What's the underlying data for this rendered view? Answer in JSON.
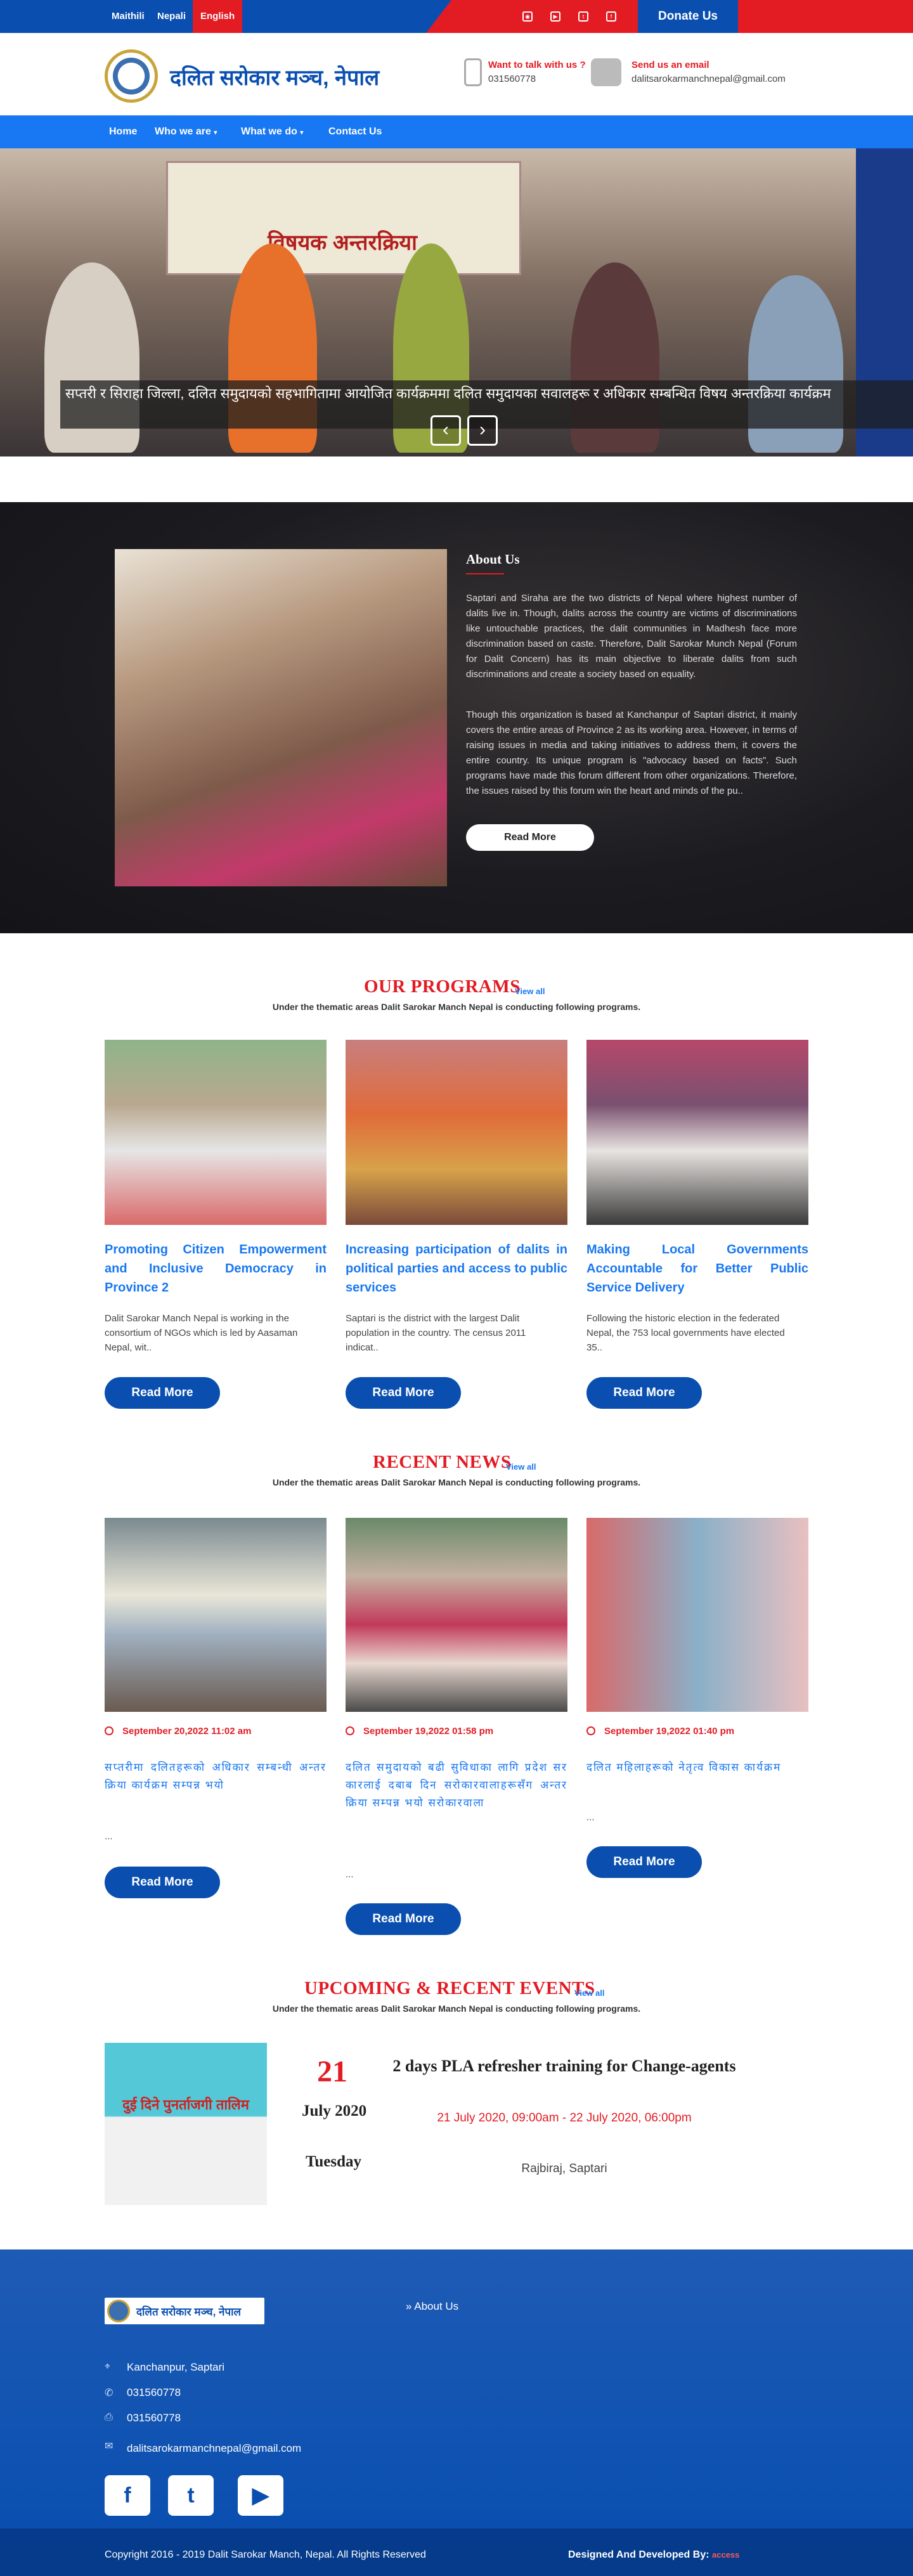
{
  "topbar": {
    "languages": [
      "Maithili",
      "Nepali",
      "English"
    ],
    "active_language": "English",
    "social_icons": [
      "instagram-icon",
      "youtube-icon",
      "twitter-icon",
      "facebook-icon"
    ],
    "donate_label": "Donate Us"
  },
  "header": {
    "site_title": "दलित सरोकार मञ्च, नेपाल",
    "phone_label": "Want to talk with us ?",
    "phone_value": "031560778",
    "email_label": "Send us an email",
    "email_value": "dalitsarokarmanchnepal@gmail.com"
  },
  "nav": {
    "items": [
      {
        "label": "Home",
        "dropdown": false
      },
      {
        "label": "Who we are",
        "dropdown": true
      },
      {
        "label": "What we do",
        "dropdown": true
      },
      {
        "label": "Contact Us",
        "dropdown": false
      }
    ]
  },
  "slider": {
    "banner_text": "विषयक अन्तरक्रिया",
    "caption": "सप्तरी र सिराहा जिल्ला, दलित समुदायको सहभागितामा आयोजित कार्यक्रममा दलित समुदायका सवालहरू र अधिकार सम्बन्धित विषय अन्तरक्रिया कार्यक्रम",
    "prev_label": "‹",
    "next_label": "›"
  },
  "about": {
    "title": "About Us",
    "paragraph1": "Saptari and Siraha are the two districts of Nepal where highest number of dalits live in. Though, dalits across the country are victims of discriminations like untouchable practices, the dalit communities in Madhesh face more discrimination based on caste. Therefore, Dalit Sarokar Munch Nepal (Forum for Dalit Concern) has its main objective to liberate dalits from such discriminations and create a society based on equality.",
    "paragraph2": "Though this organization is based at Kanchanpur of Saptari district, it mainly covers the entire areas of Province 2 as its working area. However, in terms of raising issues in media and taking initiatives to address them, it covers the entire country. Its unique program is \"advocacy based on facts\". Such programs have made this forum different from other organizations. Therefore, the issues raised by this forum win the heart and minds of the pu..",
    "button_label": "Read More"
  },
  "programs": {
    "title": "OUR PROGRAMS",
    "view_all": "View all",
    "subtitle": "Under the thematic areas Dalit Sarokar Manch Nepal is conducting following programs.",
    "items": [
      {
        "title": "Promoting Citizen Empowerment and Inclusive Democracy in Province 2",
        "desc": "Dalit Sarokar Manch Nepal is working in the consortium of NGOs which is led by Aasaman Nepal, wit..",
        "button": "Read More"
      },
      {
        "title": "Increasing participation of dalits in political parties and access to public services",
        "desc": "Saptari is the district with the largest Dalit population in the country. The census 2011 indicat..",
        "button": "Read More"
      },
      {
        "title": "Making Local Governments Accountable for Better Public Service Delivery",
        "desc": "Following the historic election in the federated Nepal, the 753 local governments have elected 35..",
        "button": "Read More"
      }
    ]
  },
  "news": {
    "title": "RECENT NEWS",
    "view_all": "View all",
    "subtitle": "Under the thematic areas Dalit Sarokar Manch Nepal is conducting following programs.",
    "items": [
      {
        "date": "September 20,2022 11:02 am",
        "text": "सप्तरीमा दलितहरूको अधिकार सम्बन्धी अन्तरक्रिया कार्यक्रम सम्पन्न भयो",
        "dots": "...",
        "button": "Read More"
      },
      {
        "date": "September 19,2022 01:58 pm",
        "text": "दलित समुदायको बढी सुविधाका लागि प्रदेश सरकारलाई दबाब दिन सरोकारवालाहरूसँग अन्तरक्रिया सम्पन्न भयो सरोकारवाला",
        "dots": "...",
        "button": "Read More"
      },
      {
        "date": "September 19,2022 01:40 pm",
        "text": "दलित महिलाहरूको नेतृत्व विकास कार्यक्रम",
        "dots": "...",
        "button": "Read More"
      }
    ]
  },
  "events": {
    "title": "UPCOMING & RECENT EVENTS",
    "view_all": "View all",
    "subtitle": "Under the thematic areas Dalit Sarokar Manch Nepal is conducting following programs.",
    "day": "21",
    "month_year": "July 2020",
    "weekday": "Tuesday",
    "event_title": "2 days PLA refresher training for Change-agents",
    "event_time": "21 July 2020, 09:00am - 22 July 2020, 06:00pm",
    "event_place": "Rajbiraj, Saptari",
    "poster_heading": "दुई दिने पुनर्ताजगी तालिम"
  },
  "footer": {
    "logo_title": "दलित सरोकार मञ्च, नेपाल",
    "link_about": "About Us",
    "address": "Kanchanpur, Saptari",
    "phone": "031560778",
    "fax": "031560778",
    "email": "dalitsarokarmanchnepal@gmail.com",
    "social": [
      {
        "name": "facebook-icon",
        "glyph": "f"
      },
      {
        "name": "twitter-icon",
        "glyph": "t"
      },
      {
        "name": "youtube-icon",
        "glyph": "▶"
      }
    ],
    "copyright": "Copyright 2016 - 2019 Dalit Sarokar Manch, Nepal. All Rights Reserved",
    "developed_by": "Designed And Developed By:",
    "developer": "access"
  },
  "colors": {
    "primary_blue": "#0a4fb0",
    "nav_blue": "#1877f2",
    "accent_red": "#e31b23"
  }
}
